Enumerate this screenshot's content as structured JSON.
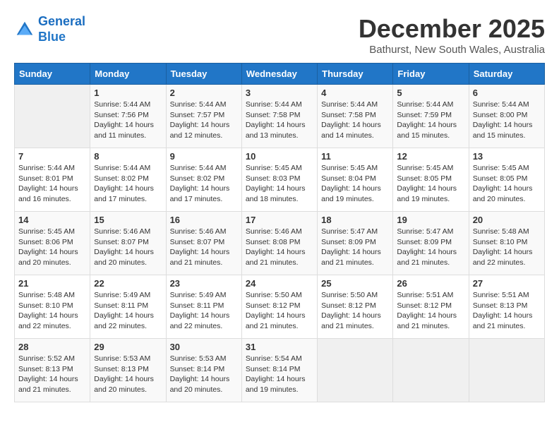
{
  "logo": {
    "line1": "General",
    "line2": "Blue"
  },
  "title": "December 2025",
  "location": "Bathurst, New South Wales, Australia",
  "days_of_week": [
    "Sunday",
    "Monday",
    "Tuesday",
    "Wednesday",
    "Thursday",
    "Friday",
    "Saturday"
  ],
  "weeks": [
    [
      {
        "day": "",
        "info": ""
      },
      {
        "day": "1",
        "info": "Sunrise: 5:44 AM\nSunset: 7:56 PM\nDaylight: 14 hours\nand 11 minutes."
      },
      {
        "day": "2",
        "info": "Sunrise: 5:44 AM\nSunset: 7:57 PM\nDaylight: 14 hours\nand 12 minutes."
      },
      {
        "day": "3",
        "info": "Sunrise: 5:44 AM\nSunset: 7:58 PM\nDaylight: 14 hours\nand 13 minutes."
      },
      {
        "day": "4",
        "info": "Sunrise: 5:44 AM\nSunset: 7:58 PM\nDaylight: 14 hours\nand 14 minutes."
      },
      {
        "day": "5",
        "info": "Sunrise: 5:44 AM\nSunset: 7:59 PM\nDaylight: 14 hours\nand 15 minutes."
      },
      {
        "day": "6",
        "info": "Sunrise: 5:44 AM\nSunset: 8:00 PM\nDaylight: 14 hours\nand 15 minutes."
      }
    ],
    [
      {
        "day": "7",
        "info": "Sunrise: 5:44 AM\nSunset: 8:01 PM\nDaylight: 14 hours\nand 16 minutes."
      },
      {
        "day": "8",
        "info": "Sunrise: 5:44 AM\nSunset: 8:02 PM\nDaylight: 14 hours\nand 17 minutes."
      },
      {
        "day": "9",
        "info": "Sunrise: 5:44 AM\nSunset: 8:02 PM\nDaylight: 14 hours\nand 17 minutes."
      },
      {
        "day": "10",
        "info": "Sunrise: 5:45 AM\nSunset: 8:03 PM\nDaylight: 14 hours\nand 18 minutes."
      },
      {
        "day": "11",
        "info": "Sunrise: 5:45 AM\nSunset: 8:04 PM\nDaylight: 14 hours\nand 19 minutes."
      },
      {
        "day": "12",
        "info": "Sunrise: 5:45 AM\nSunset: 8:05 PM\nDaylight: 14 hours\nand 19 minutes."
      },
      {
        "day": "13",
        "info": "Sunrise: 5:45 AM\nSunset: 8:05 PM\nDaylight: 14 hours\nand 20 minutes."
      }
    ],
    [
      {
        "day": "14",
        "info": "Sunrise: 5:45 AM\nSunset: 8:06 PM\nDaylight: 14 hours\nand 20 minutes."
      },
      {
        "day": "15",
        "info": "Sunrise: 5:46 AM\nSunset: 8:07 PM\nDaylight: 14 hours\nand 20 minutes."
      },
      {
        "day": "16",
        "info": "Sunrise: 5:46 AM\nSunset: 8:07 PM\nDaylight: 14 hours\nand 21 minutes."
      },
      {
        "day": "17",
        "info": "Sunrise: 5:46 AM\nSunset: 8:08 PM\nDaylight: 14 hours\nand 21 minutes."
      },
      {
        "day": "18",
        "info": "Sunrise: 5:47 AM\nSunset: 8:09 PM\nDaylight: 14 hours\nand 21 minutes."
      },
      {
        "day": "19",
        "info": "Sunrise: 5:47 AM\nSunset: 8:09 PM\nDaylight: 14 hours\nand 21 minutes."
      },
      {
        "day": "20",
        "info": "Sunrise: 5:48 AM\nSunset: 8:10 PM\nDaylight: 14 hours\nand 22 minutes."
      }
    ],
    [
      {
        "day": "21",
        "info": "Sunrise: 5:48 AM\nSunset: 8:10 PM\nDaylight: 14 hours\nand 22 minutes."
      },
      {
        "day": "22",
        "info": "Sunrise: 5:49 AM\nSunset: 8:11 PM\nDaylight: 14 hours\nand 22 minutes."
      },
      {
        "day": "23",
        "info": "Sunrise: 5:49 AM\nSunset: 8:11 PM\nDaylight: 14 hours\nand 22 minutes."
      },
      {
        "day": "24",
        "info": "Sunrise: 5:50 AM\nSunset: 8:12 PM\nDaylight: 14 hours\nand 21 minutes."
      },
      {
        "day": "25",
        "info": "Sunrise: 5:50 AM\nSunset: 8:12 PM\nDaylight: 14 hours\nand 21 minutes."
      },
      {
        "day": "26",
        "info": "Sunrise: 5:51 AM\nSunset: 8:12 PM\nDaylight: 14 hours\nand 21 minutes."
      },
      {
        "day": "27",
        "info": "Sunrise: 5:51 AM\nSunset: 8:13 PM\nDaylight: 14 hours\nand 21 minutes."
      }
    ],
    [
      {
        "day": "28",
        "info": "Sunrise: 5:52 AM\nSunset: 8:13 PM\nDaylight: 14 hours\nand 21 minutes."
      },
      {
        "day": "29",
        "info": "Sunrise: 5:53 AM\nSunset: 8:13 PM\nDaylight: 14 hours\nand 20 minutes."
      },
      {
        "day": "30",
        "info": "Sunrise: 5:53 AM\nSunset: 8:14 PM\nDaylight: 14 hours\nand 20 minutes."
      },
      {
        "day": "31",
        "info": "Sunrise: 5:54 AM\nSunset: 8:14 PM\nDaylight: 14 hours\nand 19 minutes."
      },
      {
        "day": "",
        "info": ""
      },
      {
        "day": "",
        "info": ""
      },
      {
        "day": "",
        "info": ""
      }
    ]
  ]
}
